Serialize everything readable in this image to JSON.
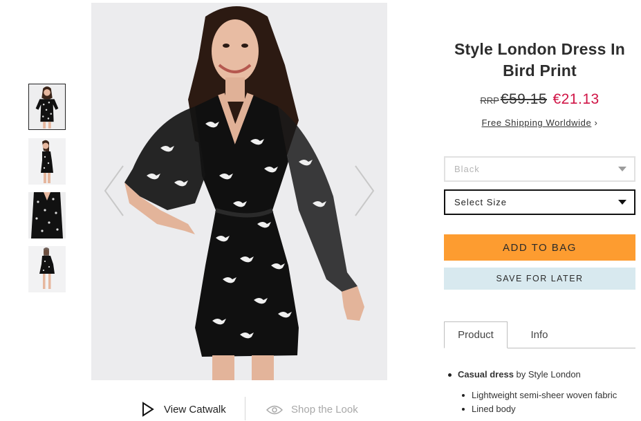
{
  "gallery": {
    "thumbnails": [
      "thumb-1",
      "thumb-2",
      "thumb-3",
      "thumb-4"
    ],
    "active_index": 0
  },
  "media_links": {
    "catwalk": "View Catwalk",
    "shop_the_look": "Shop the Look"
  },
  "product": {
    "title": "Style London Dress In Bird Print",
    "rrp_label": "RRP",
    "rrp_price": "€59.15",
    "sale_price": "€21.13",
    "shipping_link": "Free Shipping Worldwide",
    "shipping_chevron": "›"
  },
  "options": {
    "color_value": "Black",
    "size_placeholder": "Select Size"
  },
  "actions": {
    "add_to_bag": "ADD TO BAG",
    "save_for_later": "SAVE FOR LATER"
  },
  "tabs": {
    "product": "Product",
    "info": "Info"
  },
  "details": {
    "type_bold": "Casual dress",
    "type_rest": " by Style London",
    "bullets": [
      "Lightweight semi-sheer woven fabric",
      "Lined body"
    ]
  },
  "colors": {
    "sale_red": "#d01345",
    "add_to_bag_orange": "#fd9c30",
    "save_blue": "#d8e9ef"
  },
  "icons": {
    "play": "play-icon",
    "eye": "eye-icon",
    "prev": "chevron-left-icon",
    "next": "chevron-right-icon",
    "caret": "caret-down-icon"
  }
}
